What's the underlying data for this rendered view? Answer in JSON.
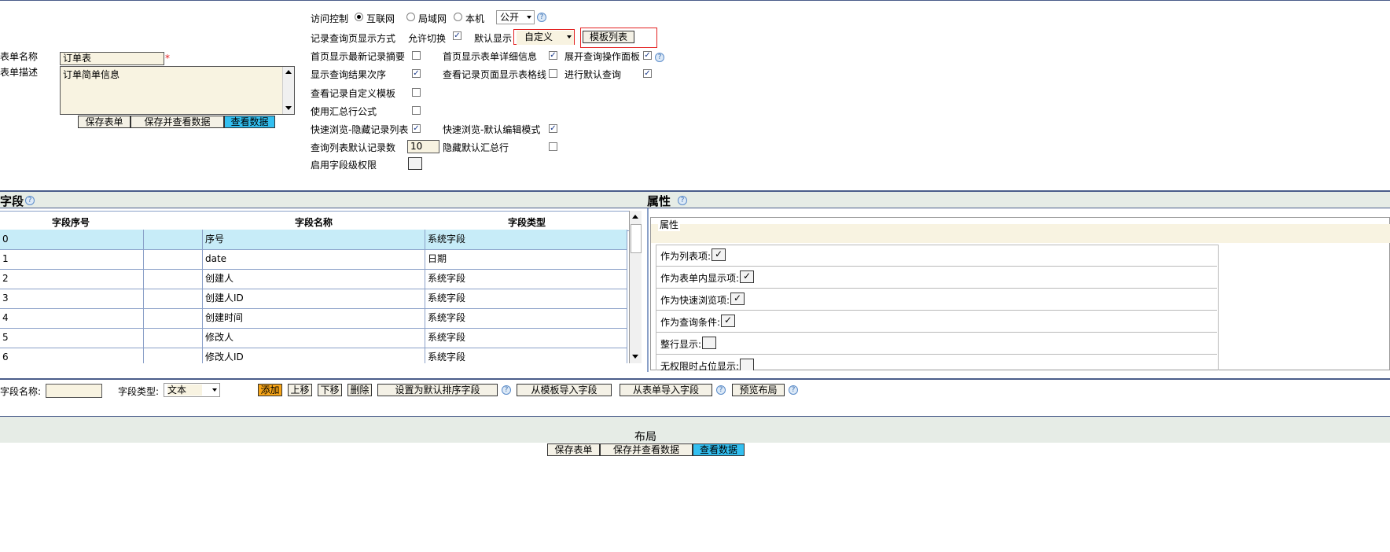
{
  "access": {
    "label": "访问控制",
    "options": [
      "互联网",
      "局域网",
      "本机"
    ],
    "selected": "互联网",
    "visibility": "公开"
  },
  "display_mode": {
    "label": "记录查询页显示方式",
    "allow_switch": "允许切换",
    "default_label": "默认显示",
    "default_value": "自定义",
    "template_list_btn": "模板列表"
  },
  "form": {
    "name_label": "表单名称",
    "name_value": "订单表",
    "desc_label": "表单描述",
    "desc_value": "订单简单信息",
    "required_mark": "*"
  },
  "top_buttons": {
    "save": "保存表单",
    "save_view": "保存并查看数据",
    "view": "查看数据"
  },
  "options": {
    "home_latest_summary": "首页显示最新记录摘要",
    "home_form_detail": "首页显示表单详细信息",
    "expand_query_panel": "展开查询操作面板",
    "show_result_order": "显示查询结果次序",
    "show_table_grid": "查看记录页面显示表格线",
    "default_query": "进行默认查询",
    "custom_template": "查看记录自定义模板",
    "use_summary_formula": "使用汇总行公式",
    "quick_hide_list": "快速浏览-隐藏记录列表",
    "quick_default_edit": "快速浏览-默认编辑模式",
    "default_count_label": "查询列表默认记录数",
    "default_count_value": "10",
    "hide_default_summary": "隐藏默认汇总行",
    "field_permission": "启用字段级权限"
  },
  "fields_section": {
    "title": "字段",
    "columns": [
      "字段序号",
      "字段名称",
      "字段类型"
    ],
    "rows": [
      {
        "no": "0",
        "name": "序号",
        "type": "系统字段"
      },
      {
        "no": "1",
        "name": "date",
        "type": "日期"
      },
      {
        "no": "2",
        "name": "创建人",
        "type": "系统字段"
      },
      {
        "no": "3",
        "name": "创建人ID",
        "type": "系统字段"
      },
      {
        "no": "4",
        "name": "创建时间",
        "type": "系统字段"
      },
      {
        "no": "5",
        "name": "修改人",
        "type": "系统字段"
      },
      {
        "no": "6",
        "name": "修改人ID",
        "type": "系统字段"
      }
    ]
  },
  "props_section": {
    "title": "属性",
    "legend": "属性",
    "items": [
      "作为列表项:",
      "作为表单内显示项:",
      "作为快速浏览项:",
      "作为查询条件:",
      "整行显示:",
      "无权限时占位显示:"
    ]
  },
  "toolbar": {
    "field_name_label": "字段名称:",
    "field_type_label": "字段类型:",
    "field_type_value": "文本",
    "add": "添加",
    "up": "上移",
    "down": "下移",
    "delete": "删除",
    "set_default_sort": "设置为默认排序字段",
    "import_from_template": "从模板导入字段",
    "import_from_form": "从表单导入字段",
    "preview_layout": "预览布局"
  },
  "layout_section": {
    "title": "布局"
  },
  "bottom_buttons": {
    "save": "保存表单",
    "save_view": "保存并查看数据",
    "view": "查看数据"
  }
}
